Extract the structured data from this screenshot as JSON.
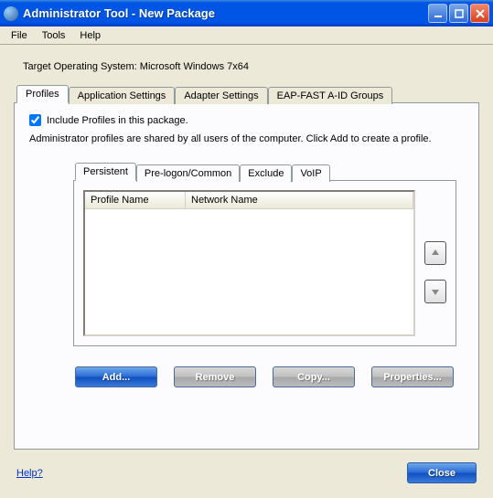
{
  "window": {
    "title": "Administrator Tool - New Package"
  },
  "menu": {
    "file": "File",
    "tools": "Tools",
    "help": "Help"
  },
  "target_os": "Target Operating System: Microsoft Windows 7x64",
  "tabs": {
    "profiles": "Profiles",
    "app_settings": "Application Settings",
    "adapter": "Adapter Settings",
    "eap": "EAP-FAST A-ID Groups"
  },
  "include_check": {
    "label": "Include Profiles in this package.",
    "checked": true
  },
  "desc": "Administrator profiles are shared by all users of the computer. Click Add to create a profile.",
  "inner_tabs": {
    "persistent": "Persistent",
    "prelogon": "Pre-logon/Common",
    "exclude": "Exclude",
    "voip": "VoIP"
  },
  "list_headers": {
    "profile": "Profile Name",
    "network": "Network Name"
  },
  "buttons": {
    "add": "Add...",
    "remove": "Remove",
    "copy": "Copy...",
    "properties": "Properties..."
  },
  "help_link": "Help?",
  "close": "Close"
}
